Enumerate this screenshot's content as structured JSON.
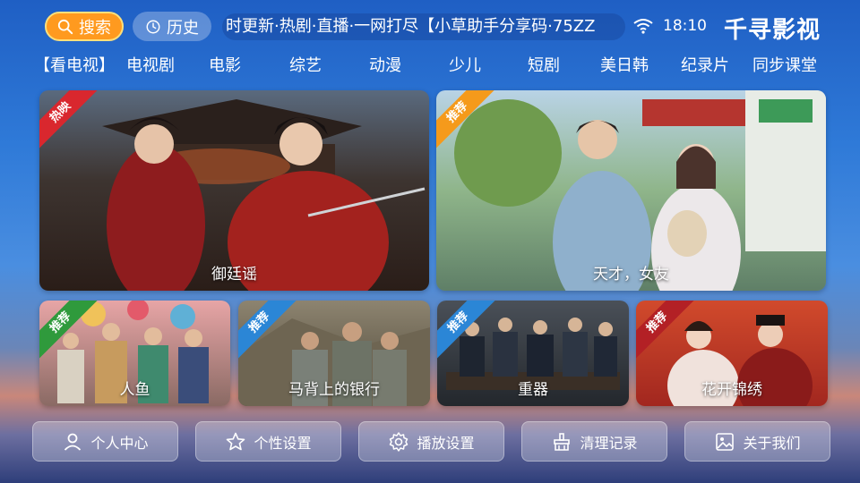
{
  "topbar": {
    "search_label": "搜索",
    "history_label": "历史",
    "marquee_text": "时更新·热剧·直播·一网打尽【小草助手分享码·75ZZ",
    "time": "18:10",
    "brand": "千寻影视"
  },
  "nav": {
    "items": [
      "【看电视】",
      "电视剧",
      "电影",
      "综艺",
      "动漫",
      "少儿",
      "短剧",
      "美日韩",
      "纪录片",
      "同步课堂"
    ]
  },
  "cards": {
    "large": [
      {
        "title": "御廷谣",
        "badge": "热映"
      },
      {
        "title": "天才，女友",
        "badge": "推荐"
      }
    ],
    "small": [
      {
        "title": "人鱼",
        "badge": "推荐"
      },
      {
        "title": "马背上的银行",
        "badge": "推荐"
      },
      {
        "title": "重器",
        "badge": "推荐"
      },
      {
        "title": "花开锦绣",
        "badge": "推荐"
      }
    ]
  },
  "bottom": {
    "profile": "个人中心",
    "personal_settings": "个性设置",
    "playback_settings": "播放设置",
    "clear_records": "清理记录",
    "about_us": "关于我们"
  },
  "colors": {
    "accent": "#ff9a1f",
    "badge_hot": "#d9272e",
    "badge_recommend_orange": "#f59a1b",
    "badge_recommend_green": "#2f9a3c",
    "badge_recommend_blue": "#2b86d6"
  }
}
